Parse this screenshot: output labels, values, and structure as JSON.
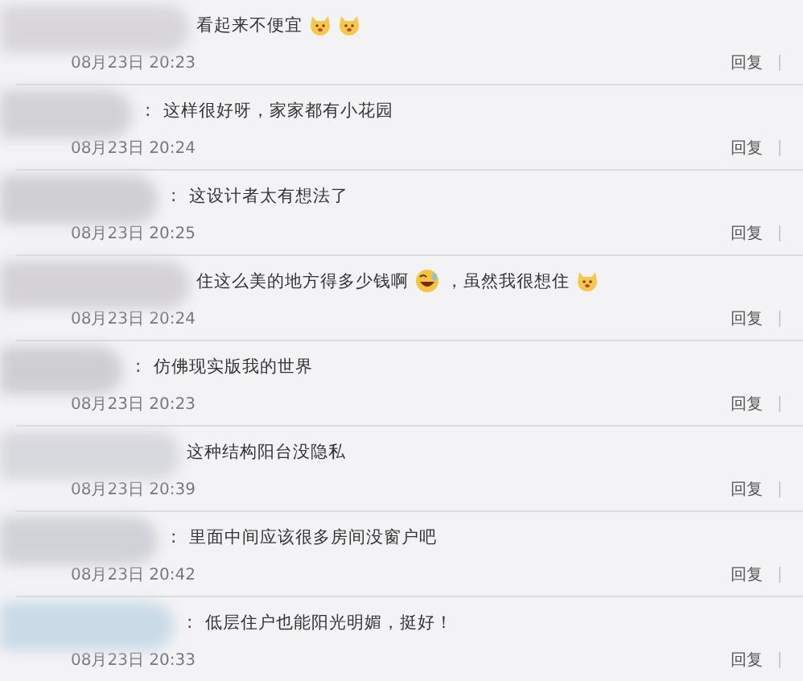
{
  "comments": [
    {
      "parts": [
        {
          "kind": "text",
          "text": "看起来不便宜"
        },
        {
          "kind": "dog"
        },
        {
          "kind": "dog"
        }
      ],
      "time": "08月23日 20:23",
      "reply": "回复"
    },
    {
      "separator": ":",
      "parts": [
        {
          "kind": "text",
          "text": "这样很好呀，家家都有小花园"
        }
      ],
      "time": "08月23日 20:24",
      "reply": "回复"
    },
    {
      "separator": ":",
      "parts": [
        {
          "kind": "text",
          "text": "这设计者太有想法了"
        }
      ],
      "time": "08月23日 20:25",
      "reply": "回复"
    },
    {
      "parts": [
        {
          "kind": "text",
          "text": "住这么美的地方得多少钱啊"
        },
        {
          "kind": "laugh"
        },
        {
          "kind": "text",
          "text": "，虽然我很想住"
        },
        {
          "kind": "dog"
        }
      ],
      "time": "08月23日 20:24",
      "reply": "回复"
    },
    {
      "separator": ":",
      "parts": [
        {
          "kind": "text",
          "text": "仿佛现实版我的世界"
        }
      ],
      "time": "08月23日 20:23",
      "reply": "回复"
    },
    {
      "parts": [
        {
          "kind": "text",
          "text": "这种结构阳台没隐私"
        }
      ],
      "time": "08月23日 20:39",
      "reply": "回复"
    },
    {
      "separator": ":",
      "parts": [
        {
          "kind": "text",
          "text": "里面中间应该很多房间没窗户吧"
        }
      ],
      "time": "08月23日 20:42",
      "reply": "回复"
    },
    {
      "separator": ":",
      "parts": [
        {
          "kind": "text",
          "text": "低层住户也能阳光明媚，挺好！"
        }
      ],
      "time": "08月23日 20:33",
      "reply": "回复"
    }
  ]
}
